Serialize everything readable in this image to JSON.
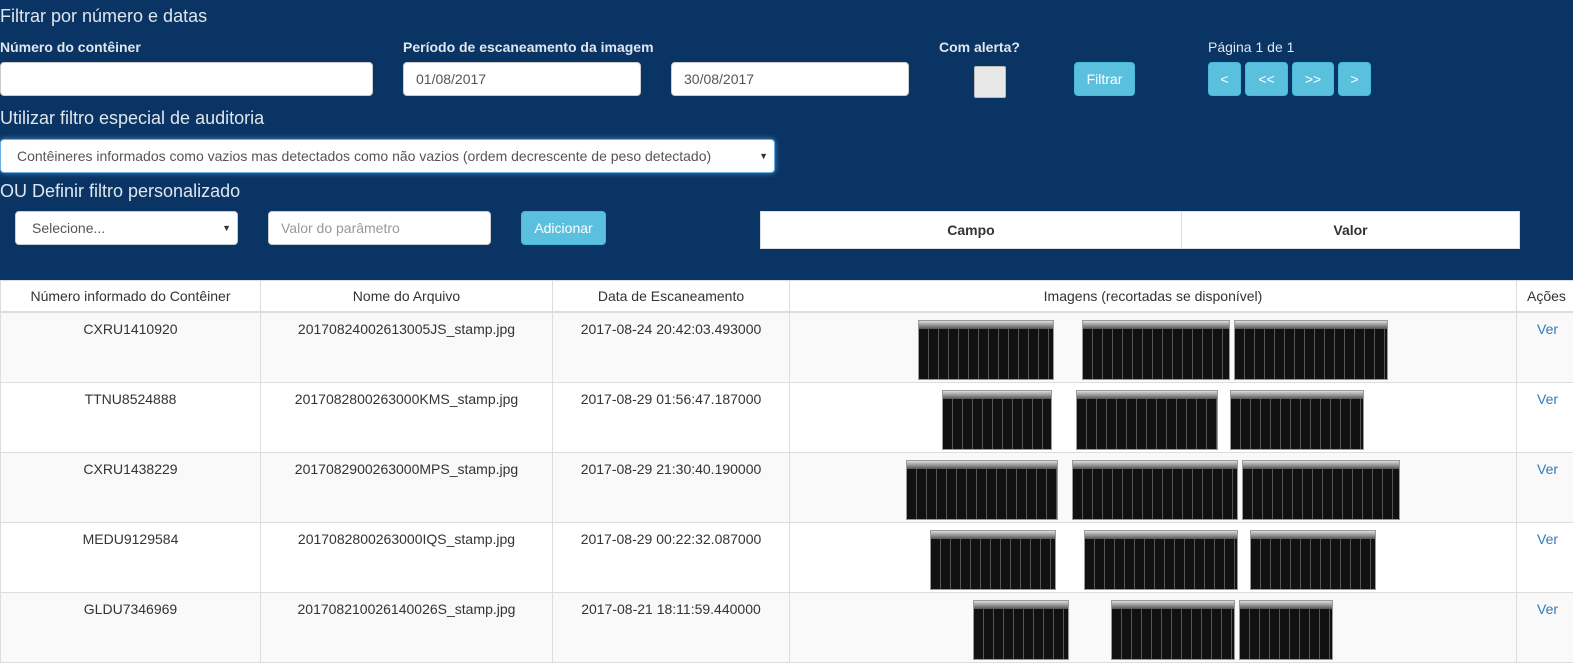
{
  "filter": {
    "title": "Filtrar por número e datas",
    "container_label": "Número do contêiner",
    "container_value": "",
    "period_label": "Período de escaneamento da imagem",
    "date_start": "01/08/2017",
    "date_end": "30/08/2017",
    "alert_label": "Com alerta?",
    "filter_button": "Filtrar",
    "page_info": "Página 1 de 1",
    "pager": [
      "<",
      "<<",
      ">>",
      ">"
    ]
  },
  "audit": {
    "title": "Utilizar filtro especial de auditoria",
    "selected": "Contêineres informados como vazios mas detectados como não vazios (ordem decrescente de peso detectado)"
  },
  "custom": {
    "title": "OU Definir filtro personalizado",
    "select_placeholder": "Selecione...",
    "param_placeholder": "Valor do parâmetro",
    "add_button": "Adicionar",
    "col_field": "Campo",
    "col_value": "Valor"
  },
  "table": {
    "headers": [
      "Número informado do Contêiner",
      "Nome do Arquivo",
      "Data de Escaneamento",
      "Imagens (recortadas se disponível)",
      "Ações"
    ],
    "rows": [
      {
        "container": "CXRU1410920",
        "file": "20170824002613005JS_stamp.jpg",
        "date": "2017-08-24 20:42:03.493000",
        "action": "Ver"
      },
      {
        "container": "TTNU8524888",
        "file": "2017082800263000KMS_stamp.jpg",
        "date": "2017-08-29 01:56:47.187000",
        "action": "Ver"
      },
      {
        "container": "CXRU1438229",
        "file": "2017082900263000MPS_stamp.jpg",
        "date": "2017-08-29 21:30:40.190000",
        "action": "Ver"
      },
      {
        "container": "MEDU9129584",
        "file": "2017082800263000IQS_stamp.jpg",
        "date": "2017-08-29 00:22:32.087000",
        "action": "Ver"
      },
      {
        "container": "GLDU7346969",
        "file": "201708210026140026S_stamp.jpg",
        "date": "2017-08-21 18:11:59.440000",
        "action": "Ver"
      }
    ]
  }
}
